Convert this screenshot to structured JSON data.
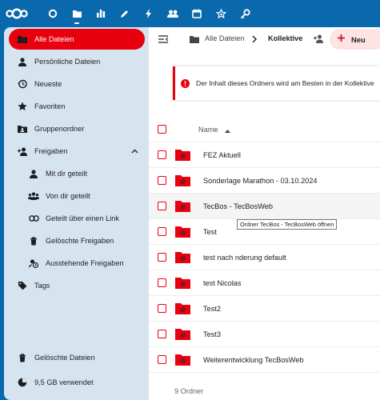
{
  "header": {
    "apps": [
      "dashboard-icon",
      "files-icon",
      "activity-icon",
      "notes-icon",
      "flash-icon",
      "contacts-icon",
      "calendar-icon",
      "collectives-icon",
      "key-icon"
    ]
  },
  "sidebar": {
    "items": [
      {
        "label": "Alle Dateien",
        "icon": "folder-icon",
        "active": true
      },
      {
        "label": "Persönliche Dateien",
        "icon": "user-icon"
      },
      {
        "label": "Neueste",
        "icon": "history-icon"
      },
      {
        "label": "Favoriten",
        "icon": "star-icon"
      },
      {
        "label": "Gruppenordner",
        "icon": "group-folder-icon"
      },
      {
        "label": "Freigaben",
        "icon": "share-icon"
      },
      {
        "label": "Mit dir geteilt",
        "icon": "user-icon"
      },
      {
        "label": "Von dir geteilt",
        "icon": "group-icon"
      },
      {
        "label": "Geteilt über einen Link",
        "icon": "link-icon"
      },
      {
        "label": "Gelöschte Freigaben",
        "icon": "deleted-share-icon"
      },
      {
        "label": "Ausstehende Freigaben",
        "icon": "pending-icon"
      },
      {
        "label": "Tags",
        "icon": "tag-icon"
      }
    ],
    "bottom": [
      {
        "label": "Gelöschte Dateien",
        "icon": "trash-icon"
      },
      {
        "label": "9,5 GB verwendet",
        "icon": "pie-chart-icon"
      }
    ]
  },
  "toolbar": {
    "breadcrumb_root": "Alle Dateien",
    "breadcrumb_current": "Kollektive",
    "new_label": "Neu"
  },
  "notice": {
    "text": "Der Inhalt dieses Ordners wird am Besten in der Kollektive"
  },
  "table": {
    "name_header": "Name",
    "rows": [
      "FEZ Aktuell",
      "Sonderlage Marathon - 03.10.2024",
      "TecBos - TecBosWeb",
      "Test",
      "test nach nderung default",
      "test Nicolas",
      "Test2",
      "Test3",
      "Weiterentwicklung TecBosWeb"
    ],
    "footer": "9 Ordner"
  },
  "tooltip": "Ordner TecBos - TecBosWeb öffnen",
  "colors": {
    "accent": "#e9000f",
    "header": "#0a69ad",
    "sidebar": "#d6e4f0"
  }
}
